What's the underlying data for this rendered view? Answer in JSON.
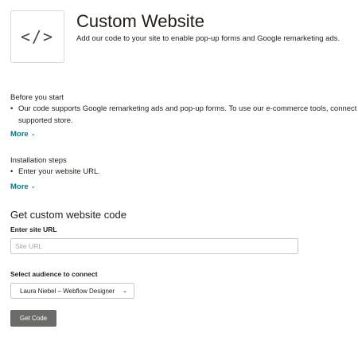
{
  "header": {
    "logo_glyph": "</>",
    "title": "Custom Website",
    "subtitle": "Add our code to your site to enable pop-up forms and Google remarketing ads."
  },
  "before_you_start": {
    "heading": "Before you start",
    "bullet_line1": "Our code supports Google remarketing ads and pop-up forms. To use our e-commerce tools, connect",
    "bullet_line2": "supported store.",
    "more_label": "More"
  },
  "installation_steps": {
    "heading": "Installation steps",
    "bullet": "Enter your website URL.",
    "more_label": "More"
  },
  "form": {
    "title": "Get custom website code",
    "site_url_label": "Enter site URL",
    "site_url_placeholder": "Site URL",
    "site_url_value": "",
    "audience_label": "Select audience to connect",
    "audience_selected": "Laura Niebel – Webflow Designer",
    "submit_label": "Get Code"
  },
  "icons": {
    "bullet_glyph": "•",
    "chevron_glyph": "⌄",
    "select_chevron_glyph": "⌄"
  },
  "colors": {
    "text": "#241c15",
    "link": "#007c89",
    "button_bg": "#6b6b67",
    "border": "#c9c9c9"
  }
}
